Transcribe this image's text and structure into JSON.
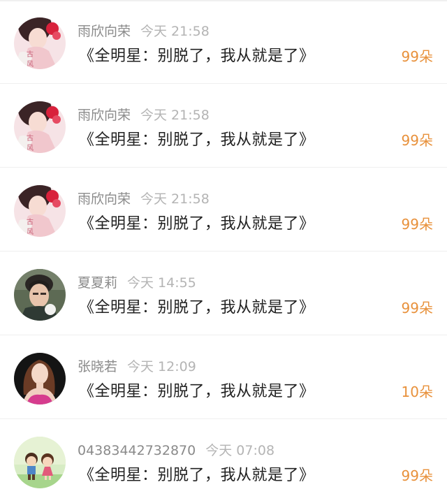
{
  "colors": {
    "name": "#8a8a8a",
    "time": "#b4b4b4",
    "message": "#222222",
    "gift": "#e8913b",
    "divider": "#efefef"
  },
  "comments": [
    {
      "name": "雨欣向荣",
      "time": "今天 21:58",
      "message": "《全明星：别脱了，我从就是了》",
      "gift": "99朵",
      "avatar": "avatar-ancient-style-girl-icon"
    },
    {
      "name": "雨欣向荣",
      "time": "今天 21:58",
      "message": "《全明星：别脱了，我从就是了》",
      "gift": "99朵",
      "avatar": "avatar-ancient-style-girl-icon"
    },
    {
      "name": "雨欣向荣",
      "time": "今天 21:58",
      "message": "《全明星：别脱了，我从就是了》",
      "gift": "99朵",
      "avatar": "avatar-ancient-style-girl-icon"
    },
    {
      "name": "夏夏莉",
      "time": "今天 14:55",
      "message": "《全明星：别脱了，我从就是了》",
      "gift": "99朵",
      "avatar": "avatar-young-man-icon"
    },
    {
      "name": "张晓若",
      "time": "今天 12:09",
      "message": "《全明星：别脱了，我从就是了》",
      "gift": "10朵",
      "avatar": "avatar-woman-pink-dress-icon"
    },
    {
      "name": "04383442732870",
      "time": "今天 07:08",
      "message": "《全明星：别脱了，我从就是了》",
      "gift": "99朵",
      "avatar": "avatar-cartoon-kids-icon"
    }
  ]
}
